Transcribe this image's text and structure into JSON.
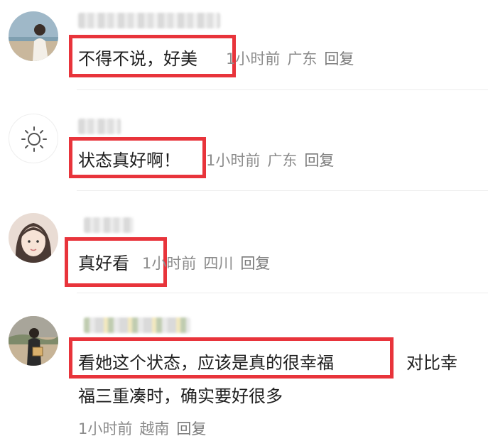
{
  "comments": [
    {
      "text": "不得不说，好美",
      "time": "1小时前",
      "location": "广东",
      "reply": "回复",
      "avatar": "photo-avatar"
    },
    {
      "text": "状态真好啊！",
      "time": "1小时前",
      "location": "广东",
      "reply": "回复",
      "avatar": "sun-icon"
    },
    {
      "text": "真好看",
      "time": "1小时前",
      "location": "四川",
      "reply": "回复",
      "avatar": "photo-avatar"
    },
    {
      "text_highlighted": "看她这个状态，应该是真的很幸福",
      "text_rest_line1": "对比幸",
      "text_line2": "福三重凑时，确实要好很多",
      "time": "1小时前",
      "location": "越南",
      "reply": "回复",
      "avatar": "photo-avatar"
    }
  ],
  "colors": {
    "highlight_border": "#e8343b",
    "meta_text": "#8c8c8c",
    "body_text": "#1f1f1f"
  }
}
